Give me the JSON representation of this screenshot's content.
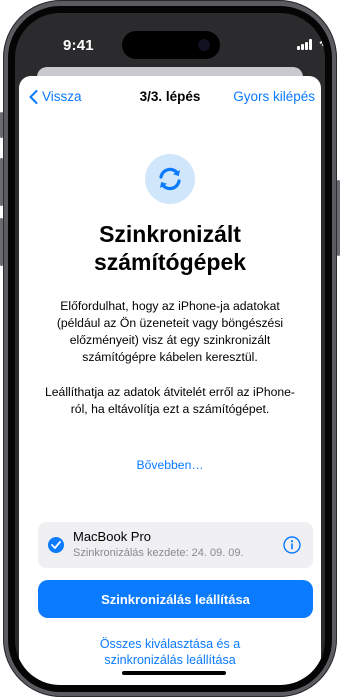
{
  "status_bar": {
    "time": "9:41"
  },
  "nav": {
    "back_label": "Vissza",
    "title": "3/3. lépés",
    "quit_label": "Gyors kilépés"
  },
  "hero": {
    "icon": "sync-arrows-icon",
    "title": "Szinkronizált számítógépek"
  },
  "body": {
    "paragraph1": "Előfordulhat, hogy az iPhone-ja adatokat (például az Ön üzeneteit vagy böngészési előzményeit) visz át egy szinkronizált számítógépre kábelen keresztül.",
    "paragraph2": "Leállíthatja az adatok átvitelét erről az iPhone-ról, ha eltávolítja ezt a számítógépet.",
    "learn_more": "Bővebben…"
  },
  "device": {
    "name": "MacBook Pro",
    "subtitle": "Szinkronizálás kezdete: 24. 09. 09.",
    "selected": true
  },
  "actions": {
    "primary": "Szinkronizálás leállítása",
    "secondary": "Összes kiválasztása és a szinkronizálás leállítása"
  },
  "colors": {
    "accent": "#0A7AFF",
    "icon_bg": "#CFE6FB",
    "card_bg": "#F0F0F3"
  }
}
